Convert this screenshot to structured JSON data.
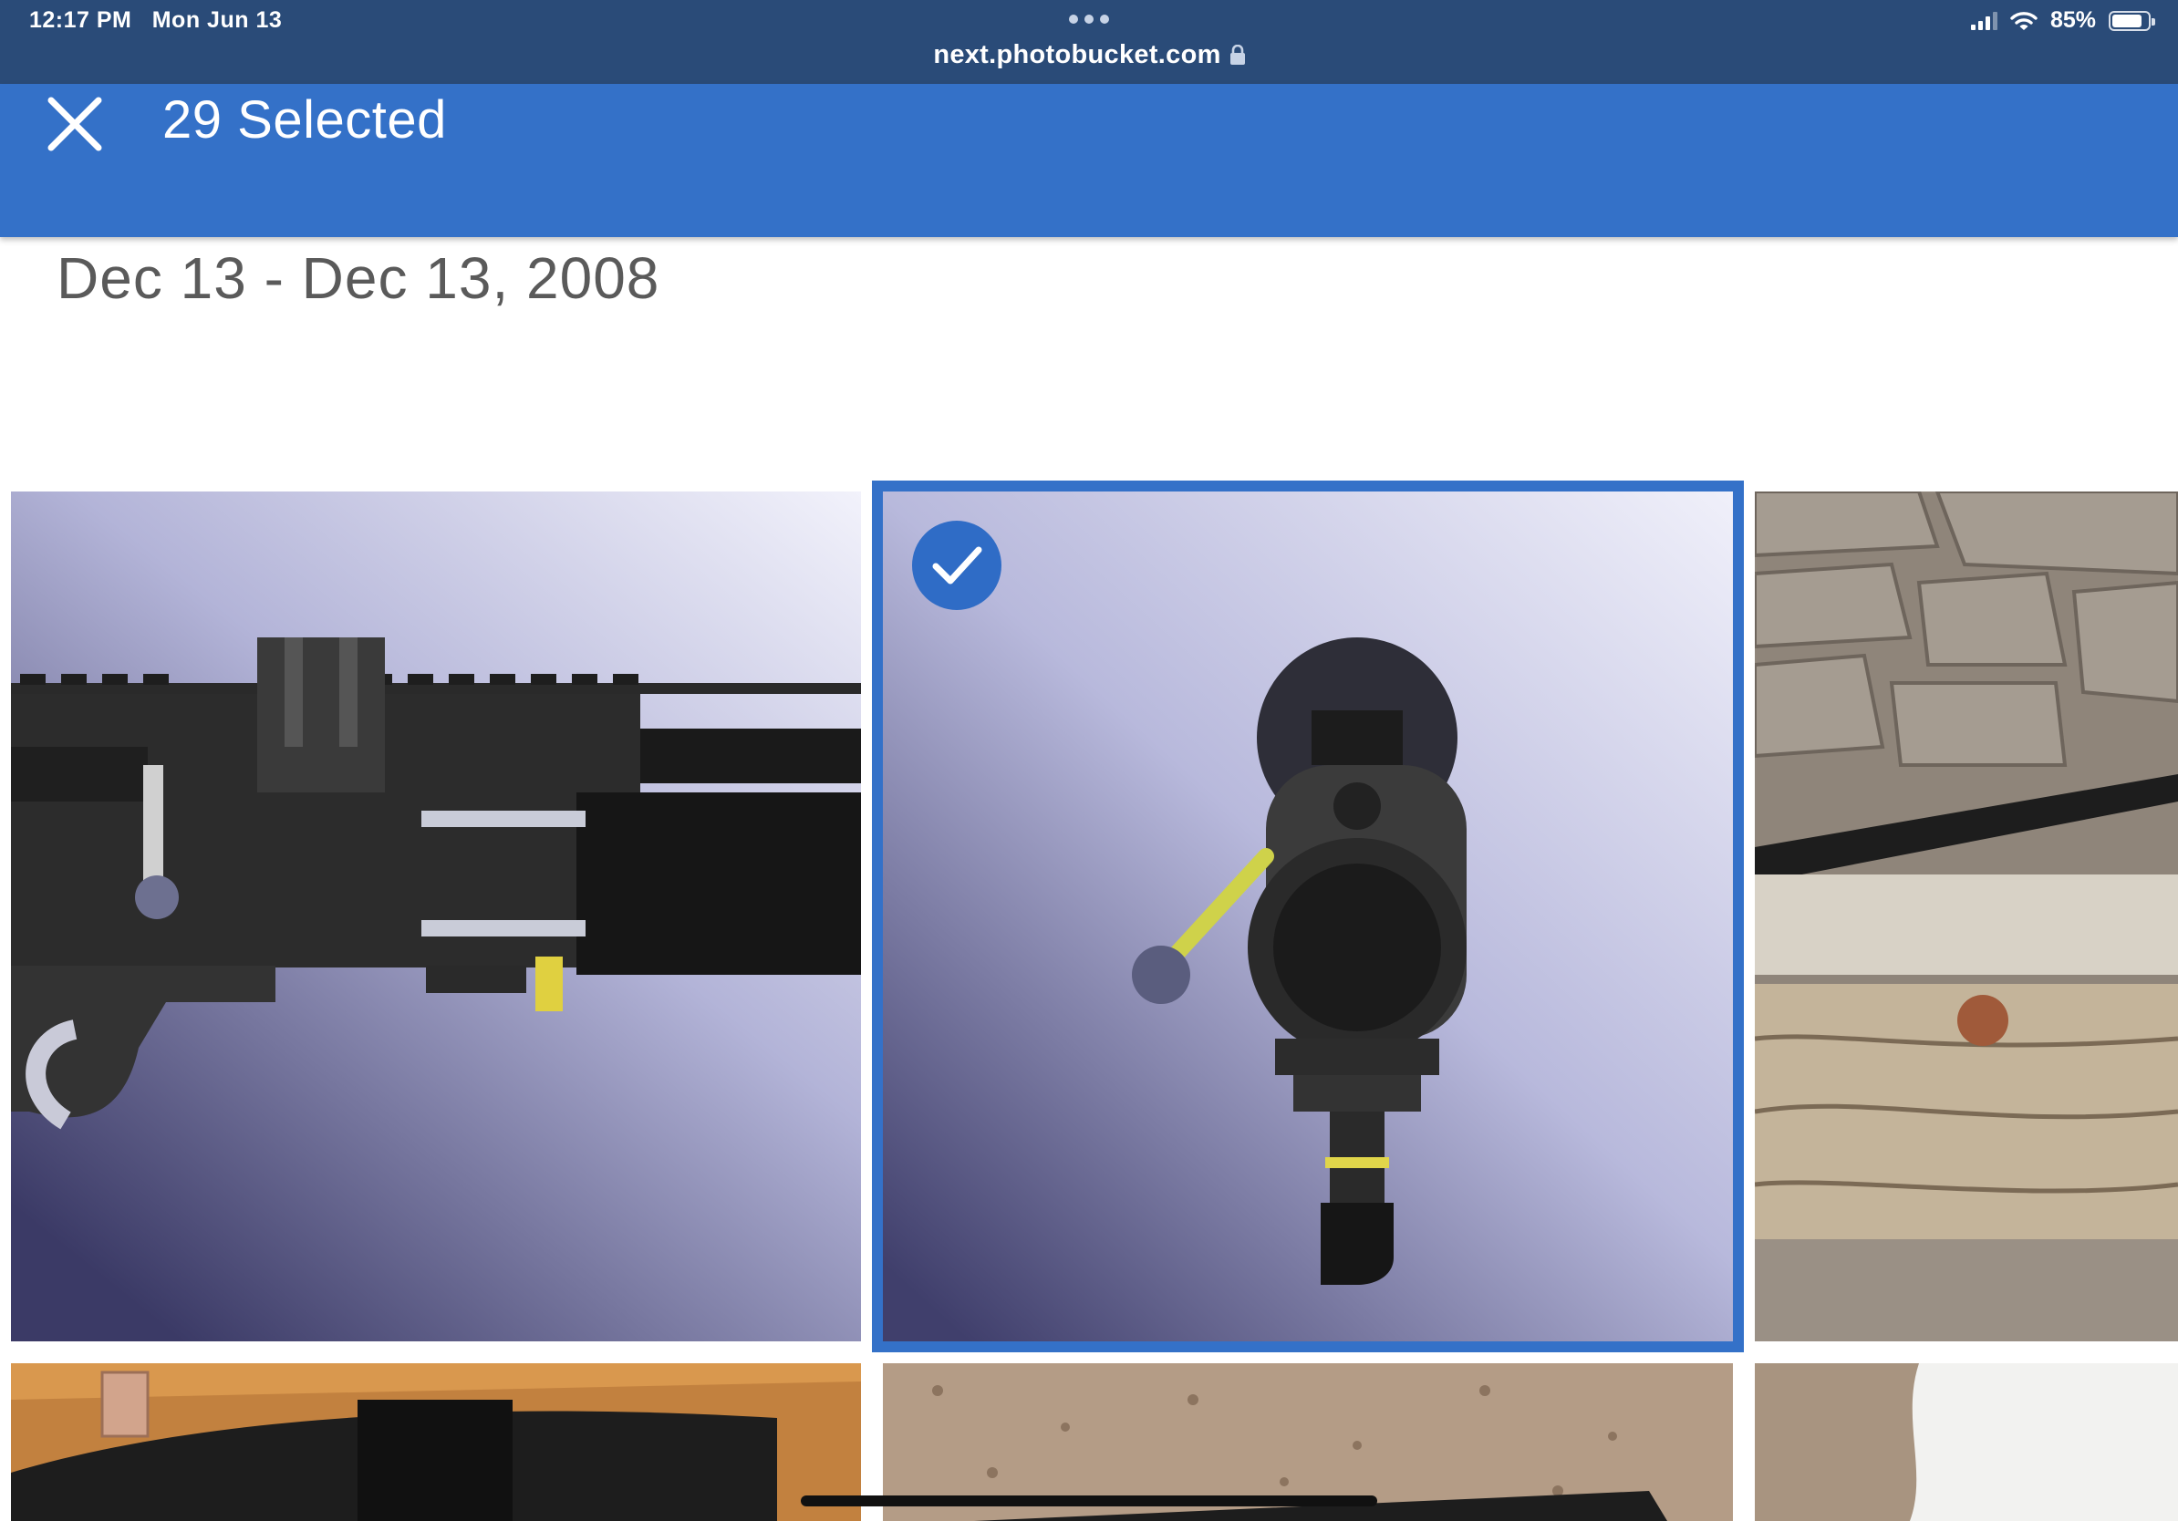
{
  "status_bar": {
    "time": "12:17 PM",
    "date": "Mon Jun 13",
    "url": "next.photobucket.com",
    "battery": "85%",
    "battery_level": 0.85
  },
  "header": {
    "selected_label": "29 Selected",
    "close_icon": "close-icon",
    "accent_color": "#3471c8"
  },
  "gallery": {
    "date_range": "Dec 13 - Dec 13, 2008",
    "photos": [
      {
        "subject": "rifle-action-side-render",
        "selected": false
      },
      {
        "subject": "rifle-action-front-render",
        "selected": true
      },
      {
        "subject": "rifle-on-log-photo",
        "selected": false
      },
      {
        "subject": "rifle-case-on-wood-floor",
        "selected": false
      },
      {
        "subject": "rail-on-carpet",
        "selected": false
      },
      {
        "subject": "carpet-and-white-wall",
        "selected": false
      }
    ]
  }
}
